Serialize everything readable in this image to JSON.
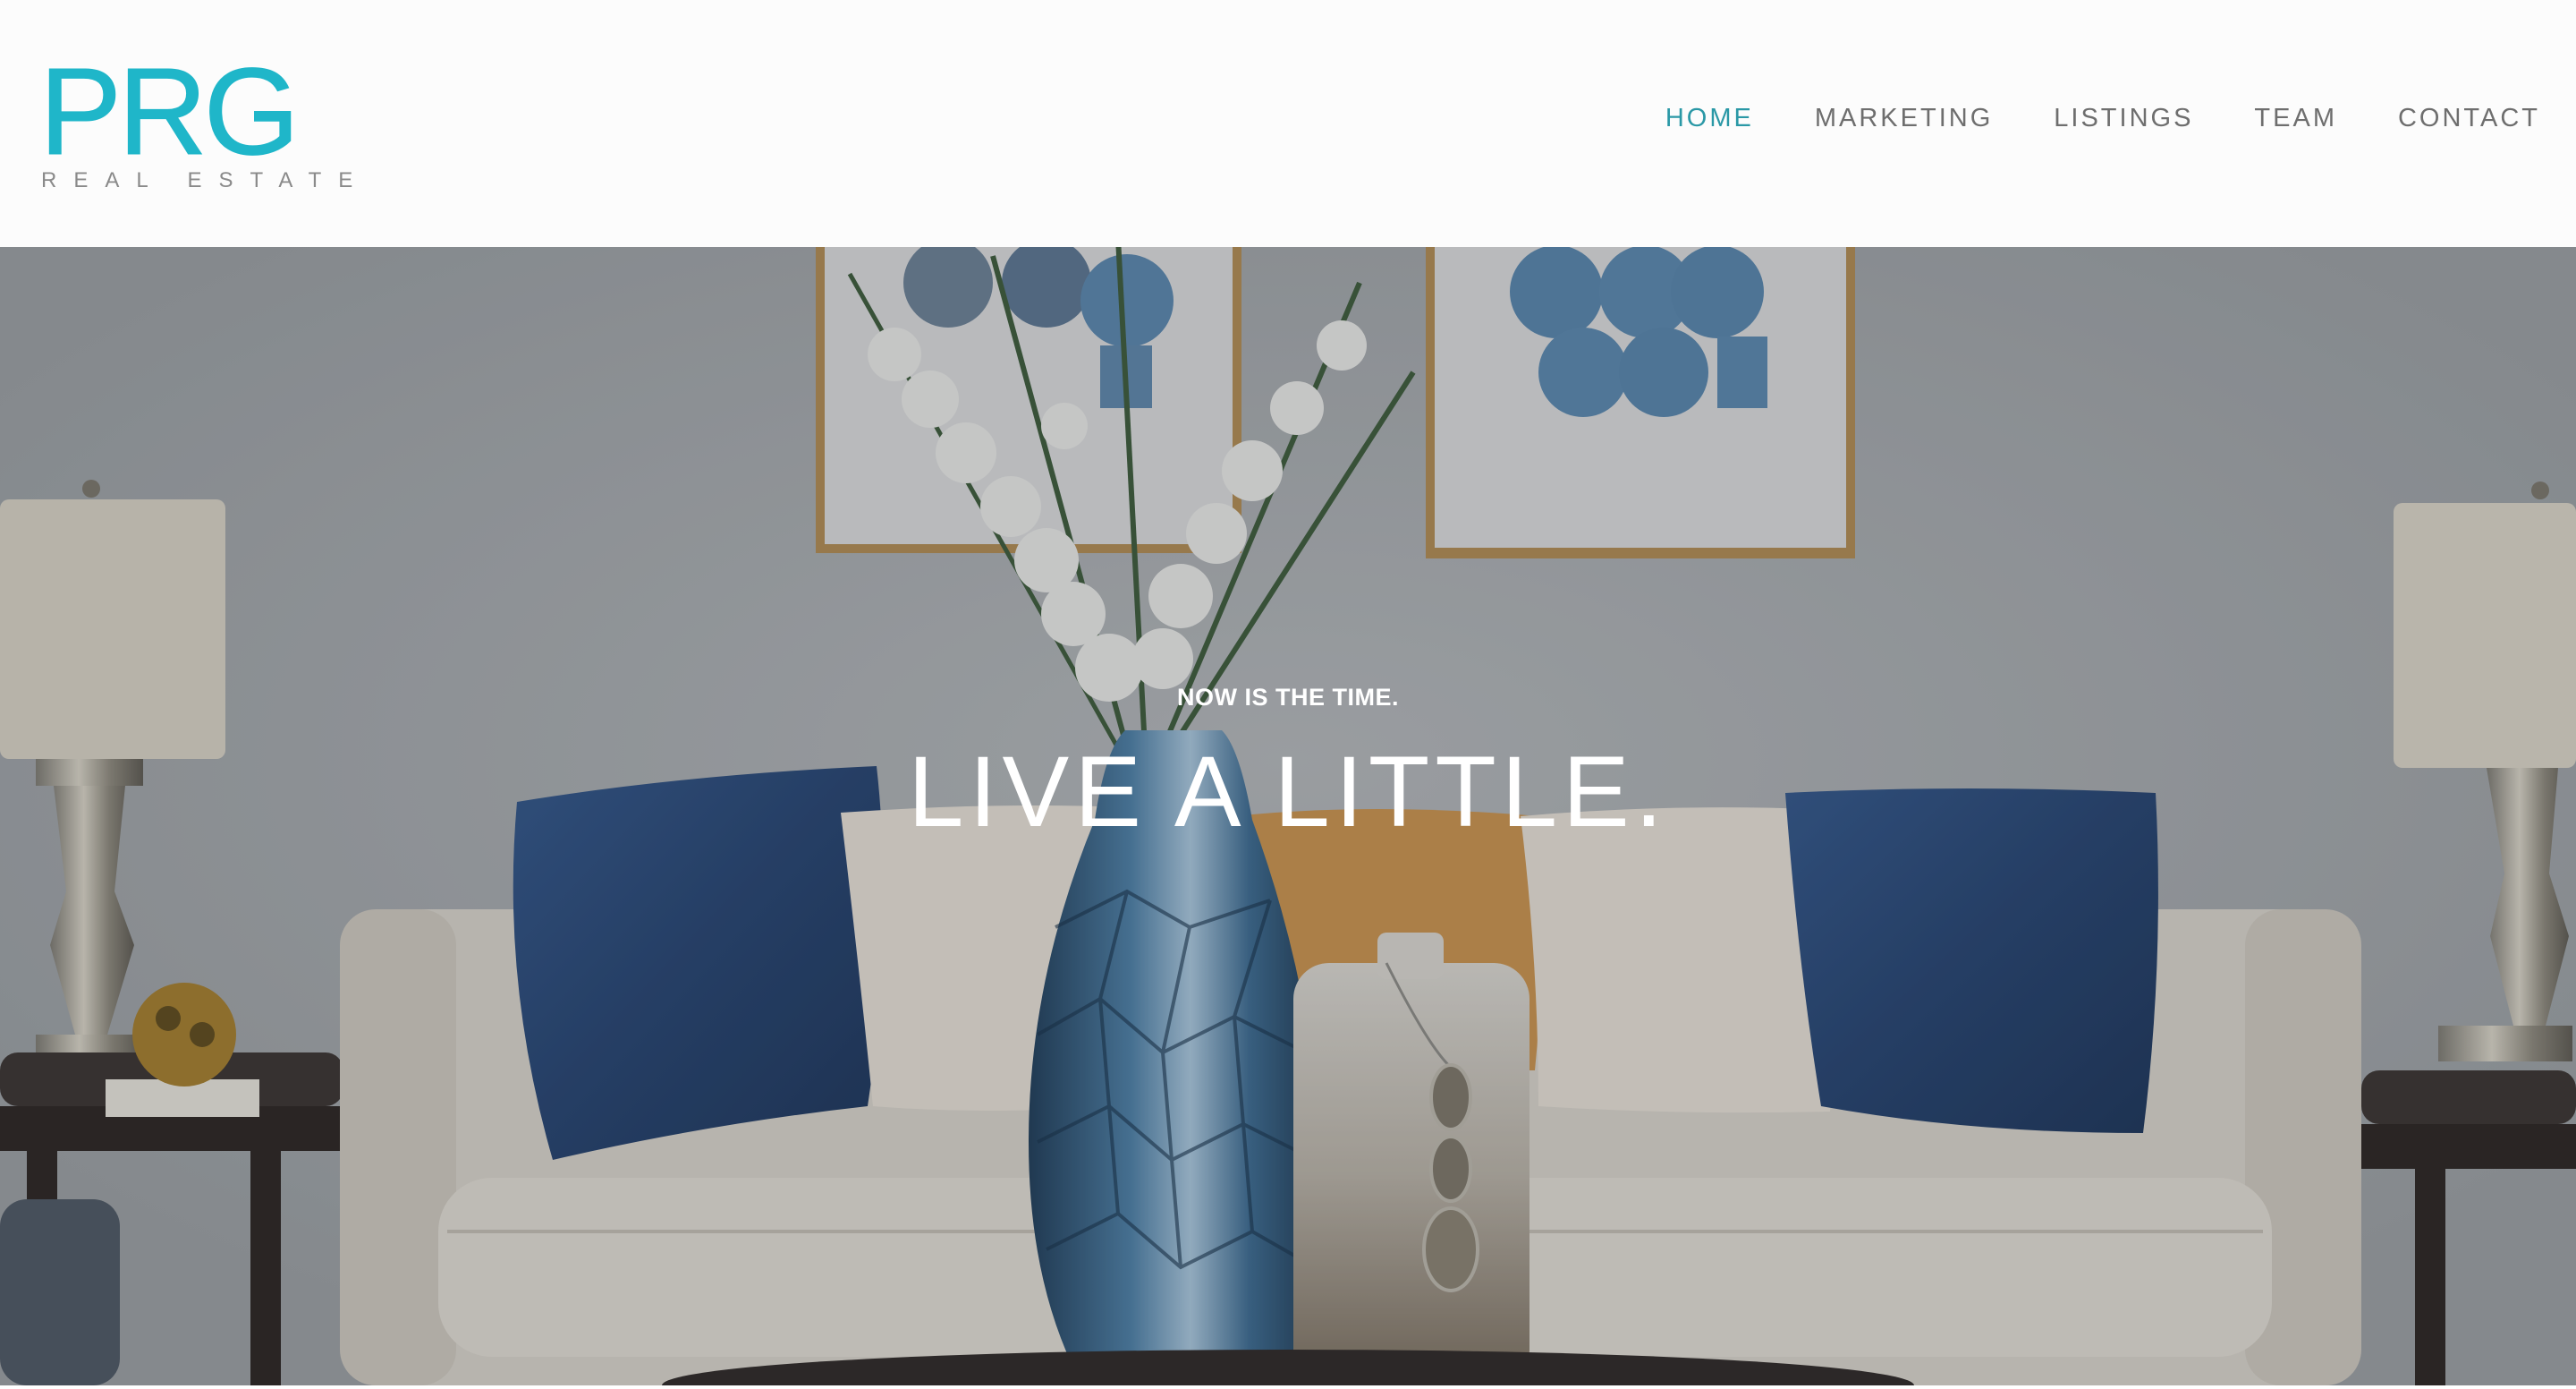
{
  "brand": {
    "logo_mark": "PRG",
    "logo_subtitle": "REAL ESTATE",
    "accent_color": "#1fb6c9"
  },
  "nav": {
    "items": [
      {
        "label": "HOME",
        "active": true
      },
      {
        "label": "MARKETING",
        "active": false
      },
      {
        "label": "LISTINGS",
        "active": false
      },
      {
        "label": "TEAM",
        "active": false
      },
      {
        "label": "CONTACT",
        "active": false
      }
    ],
    "active_color": "#2a98a6"
  },
  "hero": {
    "eyebrow": "NOW IS THE TIME.",
    "title": "LIVE A LITTLE.",
    "image_subject": "living-room-sofa-photo"
  }
}
